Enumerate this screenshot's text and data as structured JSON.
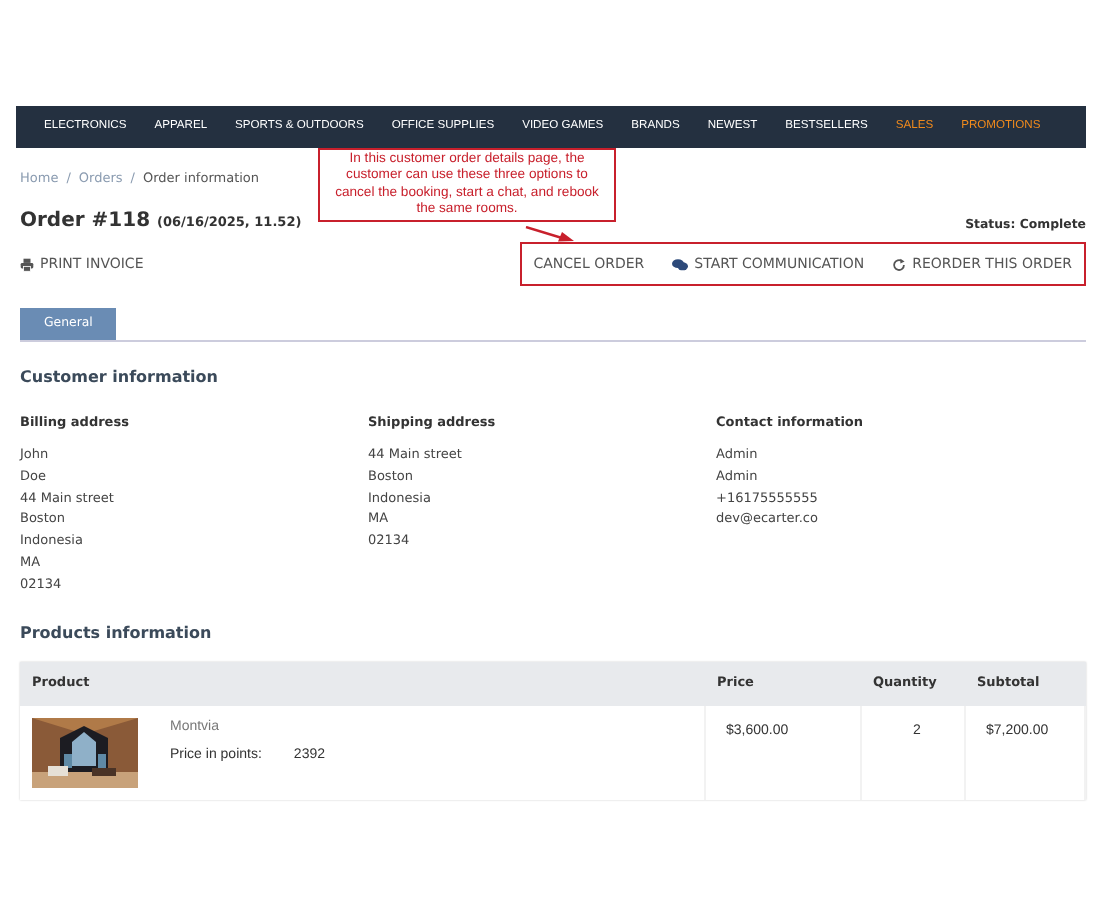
{
  "nav": [
    {
      "label": "ELECTRONICS",
      "kind": "normal"
    },
    {
      "label": "APPAREL",
      "kind": "normal"
    },
    {
      "label": "SPORTS & OUTDOORS",
      "kind": "normal"
    },
    {
      "label": "OFFICE SUPPLIES",
      "kind": "normal"
    },
    {
      "label": "VIDEO GAMES",
      "kind": "normal"
    },
    {
      "label": "BRANDS",
      "kind": "normal"
    },
    {
      "label": "NEWEST",
      "kind": "normal"
    },
    {
      "label": "BESTSELLERS",
      "kind": "normal"
    },
    {
      "label": "SALES",
      "kind": "promo"
    },
    {
      "label": "PROMOTIONS",
      "kind": "promo"
    }
  ],
  "breadcrumb": [
    {
      "label": "Home",
      "kind": "link"
    },
    {
      "label": "/",
      "kind": "separator"
    },
    {
      "label": "Orders",
      "kind": "link"
    },
    {
      "label": "/",
      "kind": "separator"
    },
    {
      "label": "Order information",
      "kind": "current"
    }
  ],
  "order": {
    "title": "Order #118",
    "date": "(06/16/2025, 11.52)",
    "status": "Status: Complete"
  },
  "print_invoice": "PRINT INVOICE",
  "actions": [
    {
      "label": "CANCEL ORDER",
      "kind": "plain"
    },
    {
      "label": "START COMMUNICATION",
      "kind": "chat"
    },
    {
      "label": "REORDER THIS ORDER",
      "kind": "reorder"
    }
  ],
  "annotation": {
    "text": "In this customer order details page, the customer can use these three options to cancel the booking, start a chat, and rebook the same rooms."
  },
  "tabs": [
    {
      "label": "General",
      "selected": true
    }
  ],
  "customer": {
    "title": "Customer information",
    "columns": [
      {
        "heading": "Billing address",
        "lines": [
          "John",
          "Doe",
          "44 Main street",
          "Boston",
          "Indonesia",
          "MA",
          "02134"
        ]
      },
      {
        "heading": "Shipping address",
        "lines": [
          "44 Main street",
          "Boston",
          "Indonesia",
          "MA",
          "02134"
        ]
      },
      {
        "heading": "Contact information",
        "lines": [
          "Admin",
          "Admin",
          "+16175555555",
          "dev@ecarter.co"
        ]
      }
    ]
  },
  "products": {
    "title": "Products information",
    "columns": [
      "Product",
      "Price",
      "Quantity",
      "Subtotal"
    ],
    "rows": [
      {
        "name": "Montvia",
        "points_label": "Price in points:",
        "points": "2392",
        "price": "$3,600.00",
        "quantity": "2",
        "subtotal": "$7,200.00"
      }
    ]
  }
}
